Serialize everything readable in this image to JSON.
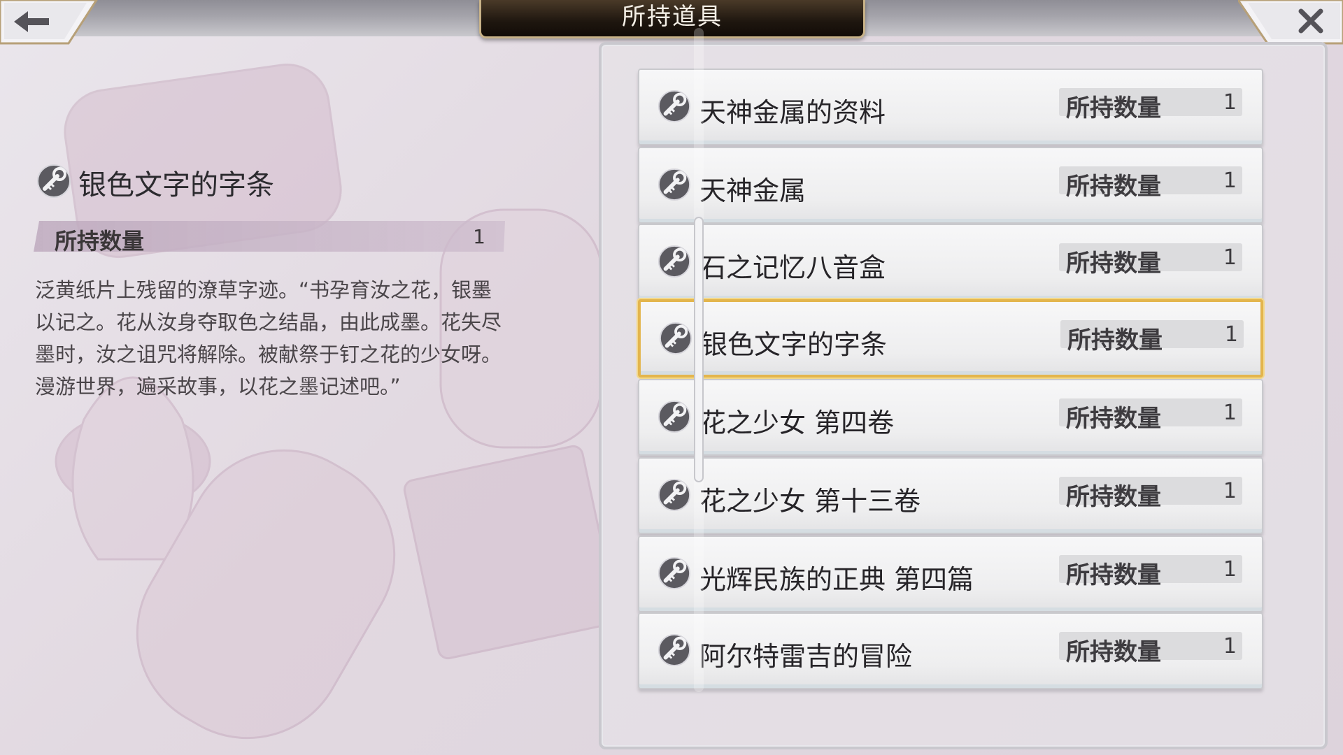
{
  "header": {
    "title": "所持道具"
  },
  "detail": {
    "name": "银色文字的字条",
    "count_label": "所持数量",
    "count": "1",
    "description": "泛黄纸片上残留的潦草字迹。“书孕育汝之花，银墨以记之。花从汝身夺取色之结晶，由此成墨。花失尽墨时，汝之诅咒将解除。被献祭于钉之花的少女呀。漫游世界，遍采故事，以花之墨记述吧。”"
  },
  "items": [
    {
      "name": "天神金属的资料",
      "count_label": "所持数量",
      "count": "1"
    },
    {
      "name": "天神金属",
      "count_label": "所持数量",
      "count": "1"
    },
    {
      "name": "石之记忆八音盒",
      "count_label": "所持数量",
      "count": "1"
    },
    {
      "name": "银色文字的字条",
      "count_label": "所持数量",
      "count": "1",
      "selected": true
    },
    {
      "name": "花之少女 第四卷",
      "count_label": "所持数量",
      "count": "1"
    },
    {
      "name": "花之少女 第十三卷",
      "count_label": "所持数量",
      "count": "1"
    },
    {
      "name": "光辉民族的正典 第四篇",
      "count_label": "所持数量",
      "count": "1"
    },
    {
      "name": "阿尔特雷吉的冒险",
      "count_label": "所持数量",
      "count": "1"
    }
  ],
  "colors": {
    "selected_border": "#e3b54d",
    "title_plate": "#1e160f"
  },
  "icons": {
    "back": "back-arrow-icon",
    "close": "close-x-icon",
    "item": "key-item-icon"
  }
}
